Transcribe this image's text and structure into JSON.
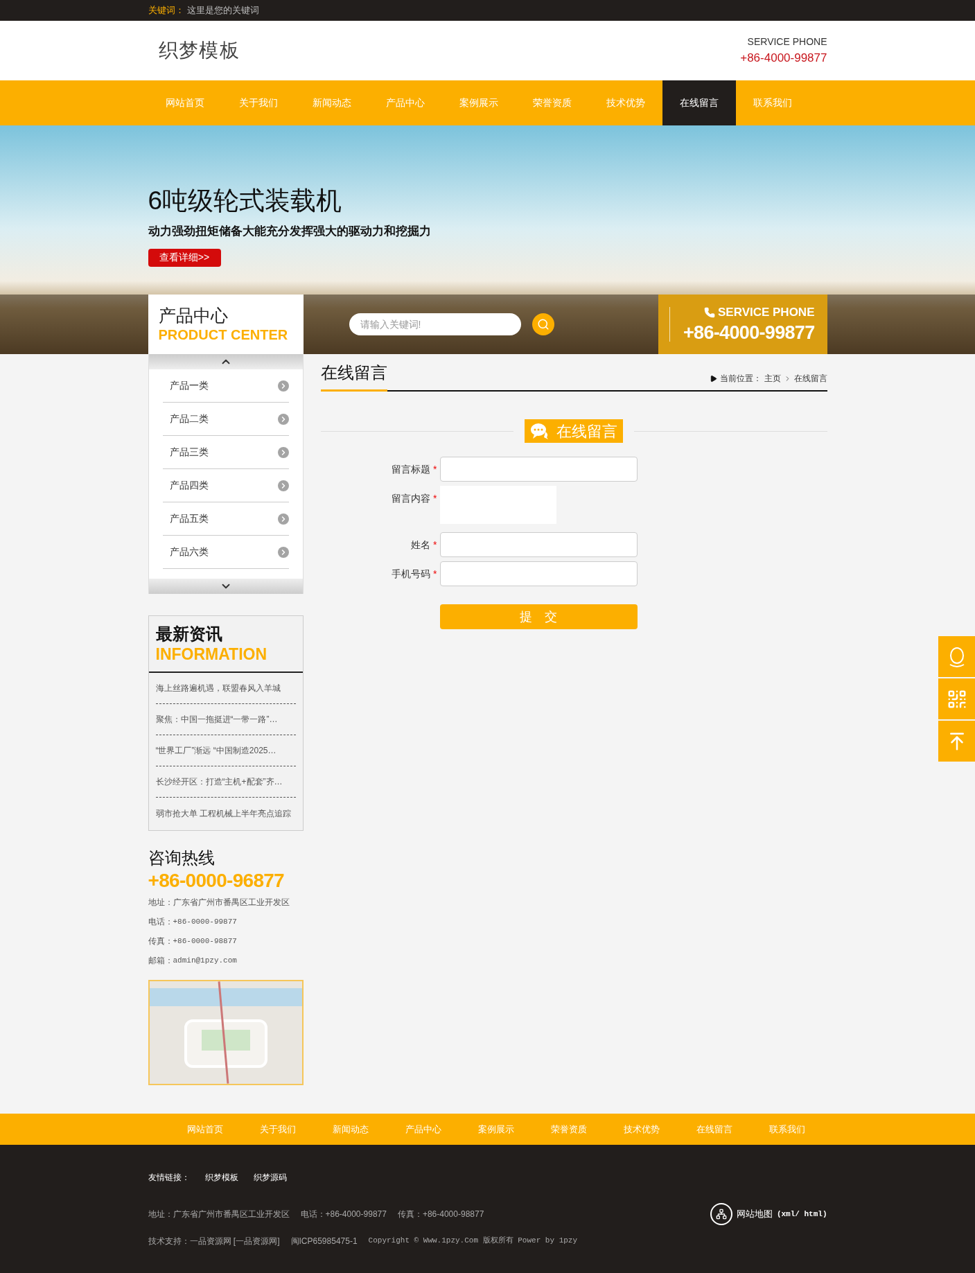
{
  "top_bar": {
    "label": "关键词：",
    "text": "这里是您的关键词"
  },
  "header": {
    "logo": "织梦模板",
    "service_label": "SERVICE PHONE",
    "service_phone": "+86-4000-99877"
  },
  "nav": [
    {
      "label": "网站首页",
      "selected": false
    },
    {
      "label": "关于我们",
      "selected": false
    },
    {
      "label": "新闻动态",
      "selected": false
    },
    {
      "label": "产品中心",
      "selected": false
    },
    {
      "label": "案例展示",
      "selected": false
    },
    {
      "label": "荣誉资质",
      "selected": false
    },
    {
      "label": "技术优势",
      "selected": false
    },
    {
      "label": "在线留言",
      "selected": true
    },
    {
      "label": "联系我们",
      "selected": false
    }
  ],
  "banner": {
    "title": "6吨级轮式装载机",
    "subtitle": "动力强劲扭矩储备大能充分发挥强大的驱动力和挖掘力",
    "button": "查看详细>>"
  },
  "product_center": {
    "title": "产品中心",
    "subtitle": "PRODUCT CENTER"
  },
  "search": {
    "placeholder": "请输入关键词!"
  },
  "service": {
    "label": "SERVICE PHONE",
    "phone": "+86-4000-99877"
  },
  "products": [
    "产品一类",
    "产品二类",
    "产品三类",
    "产品四类",
    "产品五类",
    "产品六类"
  ],
  "news": {
    "title": "最新资讯",
    "subtitle": "INFORMATION",
    "items": [
      "海上丝路遍机遇，联盟春风入羊城",
      "聚焦：中国一拖挺进“一带一路”…",
      "“世界工厂”渐远 “中国制造2025…",
      "长沙经开区：打造“主机+配套”齐…",
      "弱市抢大单 工程机械上半年亮点追踪"
    ]
  },
  "contact": {
    "title": "咨询热线",
    "phone": "+86-0000-96877",
    "lines": [
      {
        "label": "地址：",
        "value": "广东省广州市番禺区工业开发区",
        "kind": "text"
      },
      {
        "label": "电话：",
        "value": "+86-0000-99877",
        "kind": "mono"
      },
      {
        "label": "传真：",
        "value": "+86-0000-98877",
        "kind": "mono"
      },
      {
        "label": "邮箱：",
        "value": "admin@1pzy.com",
        "kind": "mono"
      }
    ]
  },
  "page": {
    "title": "在线留言",
    "breadcrumb": {
      "label": "当前位置：",
      "items": [
        "主页",
        "在线留言"
      ]
    }
  },
  "form": {
    "title": "在线留言",
    "fields": [
      {
        "label": "留言标题",
        "kind": "input",
        "required_mark": "*"
      },
      {
        "label": "留言内容",
        "kind": "textarea",
        "required_mark": "*"
      },
      {
        "label": "姓名",
        "kind": "input",
        "required_mark": "*"
      },
      {
        "label": "手机号码",
        "kind": "input",
        "required_mark": "*"
      }
    ],
    "submit": "提　交"
  },
  "footer_nav": [
    "网站首页",
    "关于我们",
    "新闻动态",
    "产品中心",
    "案例展示",
    "荣誉资质",
    "技术优势",
    "在线留言",
    "联系我们"
  ],
  "footer": {
    "links_label": "友情链接：",
    "links": [
      "织梦模板",
      "织梦源码"
    ],
    "info": [
      "地址：广东省广州市番禺区工业开发区",
      "电话：+86-4000-99877",
      "传真：+86-4000-98877"
    ],
    "sitemap": {
      "label": "网站地图",
      "formats": "(xml/ html)"
    },
    "support": [
      "技术支持：一品资源网 [一品资源网]",
      "闽ICP65985475-1",
      "Copyright © Www.1pzy.Com 版权所有 Power by 1pzy"
    ]
  }
}
